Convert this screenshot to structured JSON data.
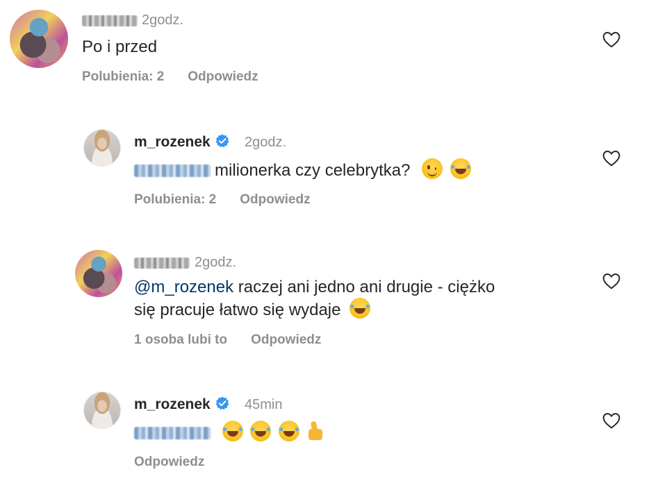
{
  "comments": [
    {
      "time": "2godz.",
      "text": "Po i przed",
      "likes": "Polubienia: 2",
      "reply": "Odpowiedz"
    },
    {
      "username": "m_rozenek",
      "time": "2godz.",
      "text": "milionerka czy celebrytka?",
      "emojis": [
        "winking-face-icon",
        "tears-of-joy-icon"
      ],
      "likes": "Polubienia: 2",
      "reply": "Odpowiedz"
    },
    {
      "time": "2godz.",
      "mention": "@m_rozenek",
      "text_line1": "raczej ani jedno ani drugie - ciężko",
      "text_line2": "się pracuje łatwo się wydaje",
      "emojis": [
        "tears-of-joy-icon"
      ],
      "likes": "1 osoba lubi to",
      "reply": "Odpowiedz"
    },
    {
      "username": "m_rozenek",
      "time": "45min",
      "emojis": [
        "tears-of-joy-icon",
        "tears-of-joy-icon",
        "tears-of-joy-icon",
        "thumbs-up-icon"
      ],
      "reply": "Odpowiedz"
    }
  ],
  "colors": {
    "text": "#262626",
    "secondary": "#8e8e8e",
    "mention": "#00376b",
    "verified": "#3897f0"
  }
}
